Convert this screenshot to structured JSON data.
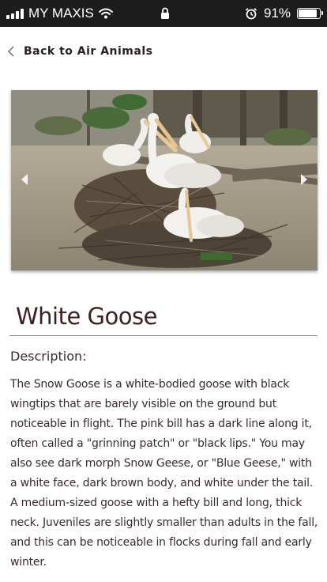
{
  "status_bar": {
    "carrier": "MY MAXIS",
    "battery_text": "91%",
    "battery_level": 0.91
  },
  "nav": {
    "back_label": "Back to Air Animals",
    "back_icon": "chevron-left-icon"
  },
  "gallery": {
    "image_name": "pelicans-nesting-photo",
    "prev_icon": "arrow-left-icon",
    "next_icon": "arrow-right-icon"
  },
  "animal": {
    "title": "White Goose",
    "description_label": "Description:",
    "description": "The Snow Goose is a white-bodied goose with black wingtips that are barely visible on the ground but noticeable in flight. The pink bill has a dark line along it, often called a \"grinning patch\" or \"black lips.\" You may also see dark morph Snow Geese, or \"Blue Geese,\" with a white face, dark brown body, and white under the tail. A medium-sized goose with a hefty bill and long, thick neck. Juveniles are slightly smaller than adults in the fall, and this can be noticeable in flocks during fall and early winter."
  },
  "colors": {
    "status_bar_bg": "#1d1d1d",
    "text": "#3a2a2a"
  }
}
